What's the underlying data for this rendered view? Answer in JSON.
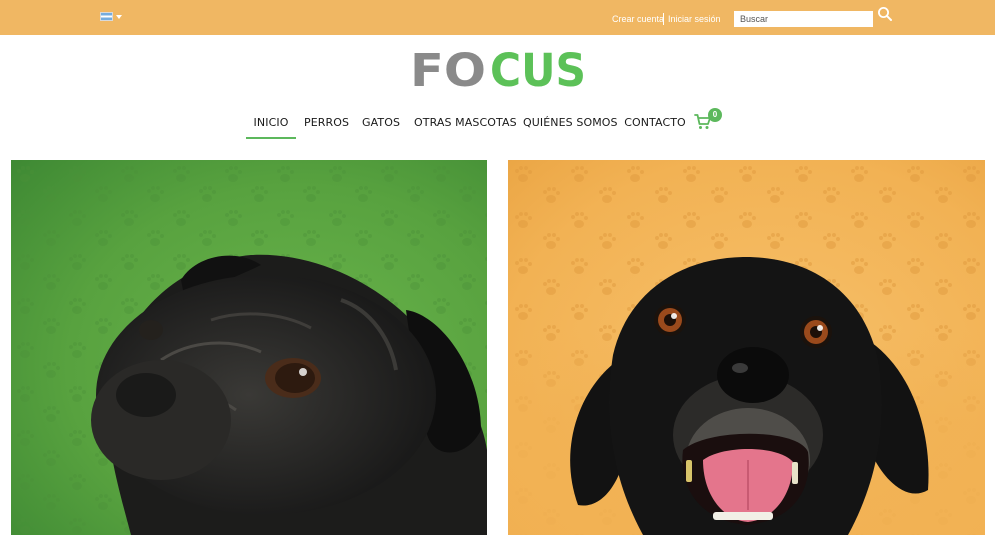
{
  "topbar": {
    "background": "#f0b763",
    "language_flag": "argentina-flag-icon",
    "create_account_label": "Crear cuenta",
    "login_label": "Iniciar sesión",
    "search": {
      "placeholder": "Buscar",
      "value": "",
      "icon": "search-icon"
    }
  },
  "logo": {
    "part_gray": "FO",
    "part_green": "CUS",
    "gray": "#8a8a8a",
    "green": "#5cc158"
  },
  "nav": {
    "items": [
      {
        "label": "INICIO",
        "active": true
      },
      {
        "label": "PERROS",
        "active": false
      },
      {
        "label": "GATOS",
        "active": false
      },
      {
        "label": "OTRAS MASCOTAS",
        "active": false
      },
      {
        "label": "QUIÉNES SOMOS",
        "active": false
      },
      {
        "label": "CONTACTO",
        "active": false
      }
    ],
    "cart_count": "0",
    "cart_icon": "shopping-cart-icon",
    "accent": "#5cb85c"
  },
  "hero": {
    "left": {
      "image": "black-pug-photo",
      "background": "#4e9a3c"
    },
    "right": {
      "image": "black-dog-photo",
      "background": "#f2b254"
    }
  }
}
